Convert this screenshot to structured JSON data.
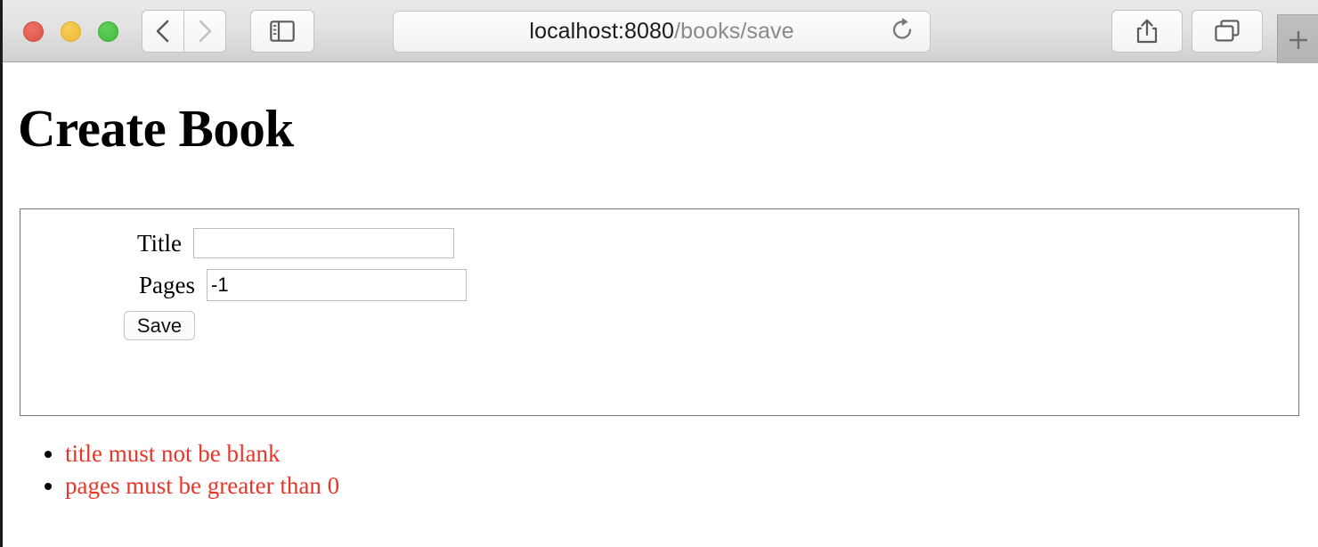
{
  "browser": {
    "name": "safari-browser-chrome",
    "traffic_lights": [
      {
        "name": "close",
        "color": "#dd5246"
      },
      {
        "name": "minimize",
        "color": "#eeb92f"
      },
      {
        "name": "maximize",
        "color": "#3fbb3d"
      }
    ],
    "nav": {
      "back_icon": "chevron-left-icon",
      "forward_icon": "chevron-right-icon",
      "sidebar_icon": "sidebar-toggle-icon"
    },
    "url_bar": {
      "host": "localhost:8080",
      "path": "/books/save",
      "full_url": "localhost:8080/books/save",
      "reload_icon": "reload-icon"
    },
    "right_tools": {
      "share_icon": "share-icon",
      "tabs_icon": "tab-overview-icon",
      "new_tab_label": "+"
    }
  },
  "main": {
    "heading": "Create Book",
    "form": {
      "fields": [
        {
          "label": "Title",
          "value": "",
          "placeholder": "",
          "type": "text",
          "name": "title"
        },
        {
          "label": "Pages",
          "value": "-1",
          "placeholder": "",
          "type": "text",
          "name": "pages"
        }
      ],
      "submit_label": "Save"
    },
    "errors": [
      "title must not be blank",
      "pages must be greater than 0"
    ],
    "error_color": "#e8362a"
  }
}
